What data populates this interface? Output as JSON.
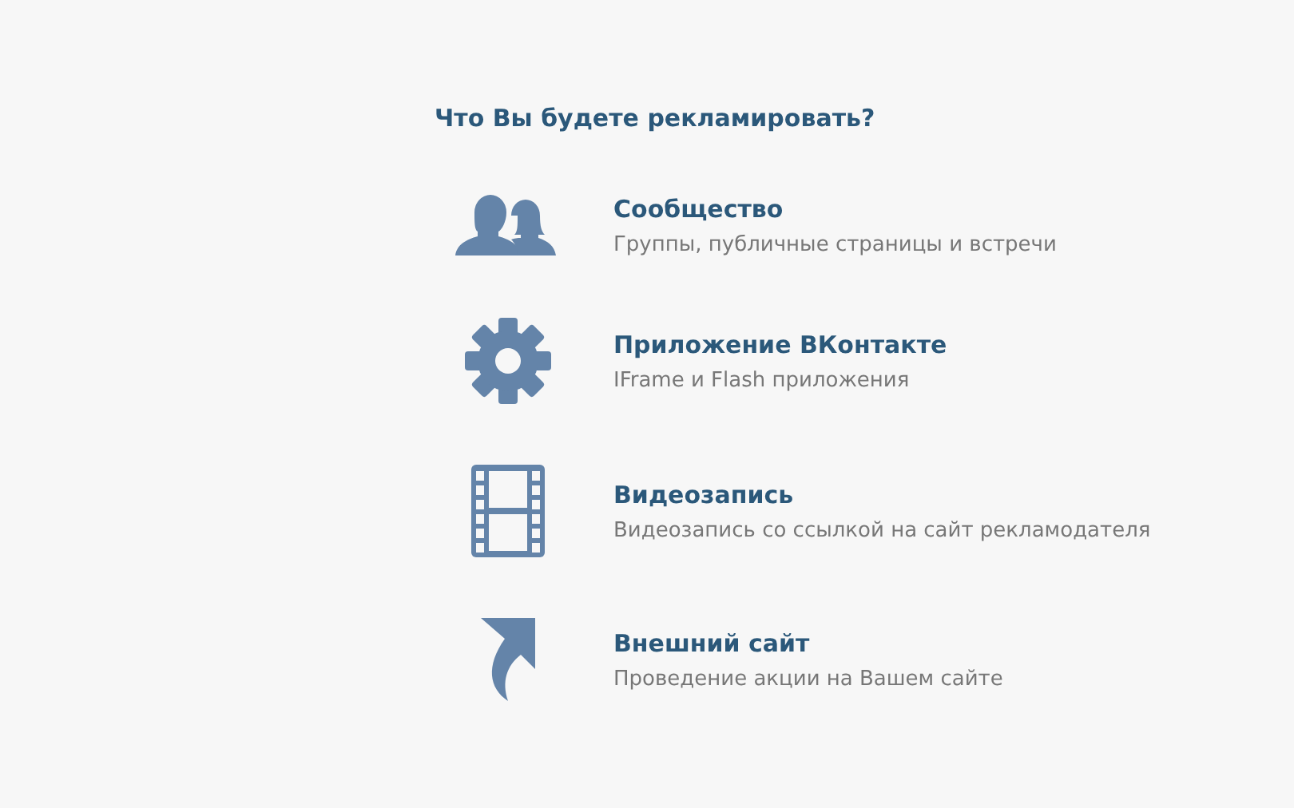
{
  "heading": "Что Вы будете рекламировать?",
  "options": [
    {
      "kind": "community",
      "title": "Сообщество",
      "description": "Группы, публичные страницы и встречи"
    },
    {
      "kind": "app",
      "title": "Приложение ВКонтакте",
      "description": "IFrame и Flash приложения"
    },
    {
      "kind": "video",
      "title": "Видеозапись",
      "description": "Видеозапись со ссылкой на сайт рекламодателя"
    },
    {
      "kind": "site",
      "title": "Внешний сайт",
      "description": "Проведение акции на Вашем сайте"
    }
  ]
}
